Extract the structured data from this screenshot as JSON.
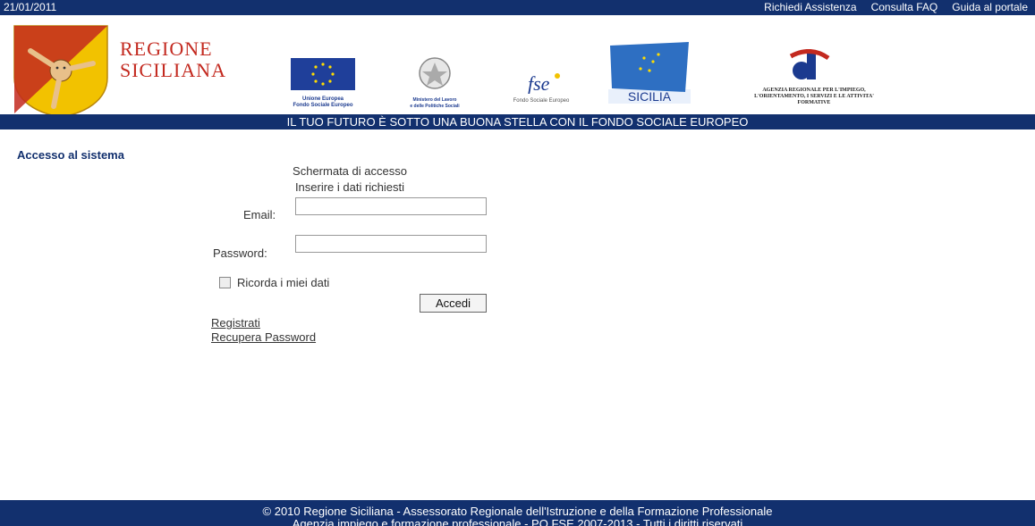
{
  "topbar": {
    "date": "21/01/2011",
    "links": [
      "Richiedi Assistenza",
      "Consulta FAQ",
      "Guida al portale"
    ]
  },
  "header": {
    "title_line1": "REGIONE",
    "title_line2": "SICILIANA",
    "logos": [
      {
        "name": "eu",
        "caption": "Unione Europea\nFondo Sociale Europeo"
      },
      {
        "name": "ministero",
        "caption": "Ministero del Lavoro\ne delle Politiche Sociali"
      },
      {
        "name": "fse",
        "caption": "Fondo Sociale Europeo"
      },
      {
        "name": "sicilia",
        "caption": "SICILIA"
      },
      {
        "name": "agenzia",
        "caption": "AGENZIA REGIONALE PER L'IMPIEGO,\nL'ORIENTAMENTO, I SERVIZI E LE ATTIVITA'\nFORMATIVE"
      }
    ],
    "slogan": "IL TUO FUTURO È SOTTO UNA BUONA STELLA CON IL FONDO SOCIALE EUROPEO"
  },
  "sidebar": {
    "heading": "Accesso al sistema"
  },
  "login": {
    "title": "Schermata di accesso",
    "subtitle": "Inserire i dati richiesti",
    "email_label": "Email:",
    "email_value": "",
    "password_label": "Password:",
    "password_value": "",
    "remember_label": "Ricorda i miei dati",
    "submit_label": "Accedi",
    "register_link": "Registrati",
    "recover_link": "Recupera Password"
  },
  "footer": {
    "line1": "© 2010 Regione Siciliana - Assessorato Regionale dell'Istruzione e della Formazione Professionale",
    "line2": "Agenzia impiego e formazione professionale - PO FSE 2007-2013 - Tutti i diritti riservati"
  },
  "colors": {
    "navy": "#12306e",
    "brand_red": "#c3291f",
    "crest_yellow": "#f2c200"
  }
}
